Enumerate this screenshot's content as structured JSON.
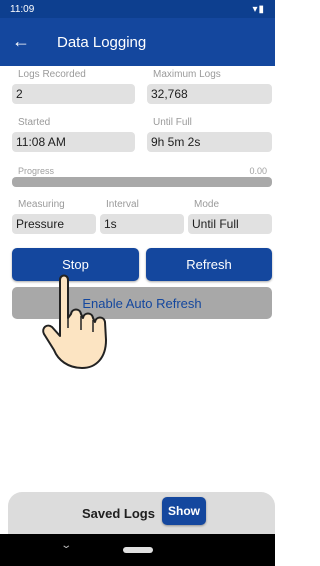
{
  "status_bar": {
    "time": "11:09",
    "indicators": "▾▮",
    "icons": [
      "wifi-icon",
      "battery-icon"
    ]
  },
  "app_bar": {
    "back_glyph": "←",
    "title": "Data Logging",
    "color": "#14479e"
  },
  "fields": {
    "logs_recorded": {
      "label": "Logs Recorded",
      "value": "2"
    },
    "maximum_logs": {
      "label": "Maximum Logs",
      "value": "32,768"
    },
    "started": {
      "label": "Started",
      "value": "11:08 AM"
    },
    "until_full": {
      "label": "Until Full",
      "value": "9h 5m 2s"
    }
  },
  "progress": {
    "label": "Progress",
    "value_text": "0.00",
    "fraction": 0.0
  },
  "settings": {
    "measuring": {
      "label": "Measuring",
      "value": "Pressure"
    },
    "interval": {
      "label": "Interval",
      "value": "1s"
    },
    "mode": {
      "label": "Mode",
      "value": "Until Full"
    }
  },
  "buttons": {
    "stop": "Stop",
    "refresh": "Refresh",
    "auto_refresh": "Enable Auto Refresh"
  },
  "saved_logs": {
    "label": "Saved Logs",
    "show": "Show"
  },
  "nav": {
    "back_glyph": "⌄"
  },
  "colors": {
    "primary": "#14479e",
    "status_bar": "#0d3f8f",
    "field_bg": "#e1e1e1",
    "disabled": "#a8a8a8"
  }
}
